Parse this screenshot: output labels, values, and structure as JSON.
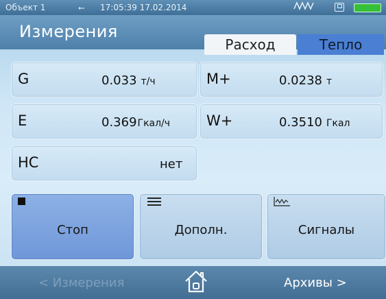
{
  "status": {
    "object": "Объект 1",
    "usb_icon": "usb-icon",
    "datetime": "17:05:39 17.02.2014",
    "signal_icon": "signal-wave-icon",
    "card_icon": "sd-card-icon",
    "battery_icon": "battery-icon",
    "battery_color": "#35c03a"
  },
  "header": {
    "title": "Измерения",
    "tabs": [
      {
        "label": "Расход",
        "selected": false
      },
      {
        "label": "Тепло",
        "selected": true
      }
    ],
    "accent": "#4a7fd4"
  },
  "cells": {
    "g": {
      "label": "G",
      "value": "0.033",
      "unit": "т/ч"
    },
    "m": {
      "label": "M+",
      "value": "0.0238",
      "unit": "т"
    },
    "e": {
      "label": "E",
      "value": "0.369",
      "unit": "Гкал/ч"
    },
    "w": {
      "label": "W+",
      "value": "0.3510",
      "unit": "Гкал"
    },
    "nc": {
      "label": "НС",
      "value": "нет",
      "unit": ""
    }
  },
  "buttons": {
    "stop": {
      "label": "Стоп",
      "icon": "stop-icon",
      "active": true
    },
    "more": {
      "label": "Дополн.",
      "icon": "menu-icon"
    },
    "signals": {
      "label": "Сигналы",
      "icon": "signal-graph-icon"
    }
  },
  "nav": {
    "back": "< Измерения",
    "home_icon": "home-icon",
    "forward": "Архивы >"
  }
}
